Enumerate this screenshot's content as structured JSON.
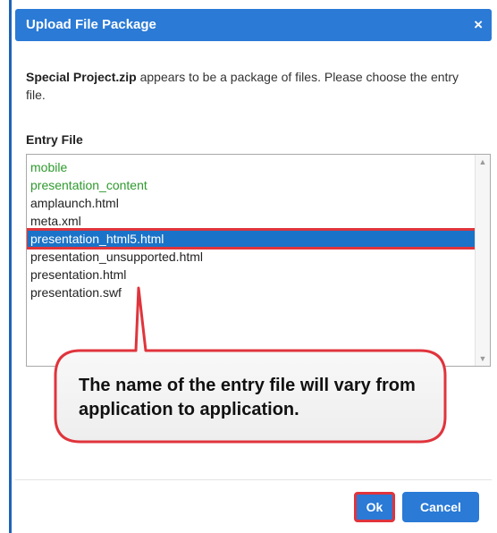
{
  "dialog": {
    "title": "Upload File Package",
    "close_label": "×"
  },
  "intro": {
    "filename": "Special Project.zip",
    "message": " appears to be a package of files. Please choose the entry file."
  },
  "entry_label": "Entry File",
  "entry_list": [
    {
      "name": "mobile",
      "kind": "folder"
    },
    {
      "name": "presentation_content",
      "kind": "folder"
    },
    {
      "name": "amplaunch.html",
      "kind": "file"
    },
    {
      "name": "meta.xml",
      "kind": "file"
    },
    {
      "name": "presentation_html5.html",
      "kind": "file",
      "selected": true
    },
    {
      "name": "presentation_unsupported.html",
      "kind": "file"
    },
    {
      "name": "presentation.html",
      "kind": "file"
    },
    {
      "name": "presentation.swf",
      "kind": "file"
    }
  ],
  "callout": {
    "text": "The name of the entry file will vary from application to application."
  },
  "buttons": {
    "ok": "Ok",
    "cancel": "Cancel"
  },
  "colors": {
    "title_bar": "#2a7ad6",
    "highlight_border": "#e0343c",
    "selection": "#1a73c8",
    "folder_text": "#2e9a2e"
  }
}
